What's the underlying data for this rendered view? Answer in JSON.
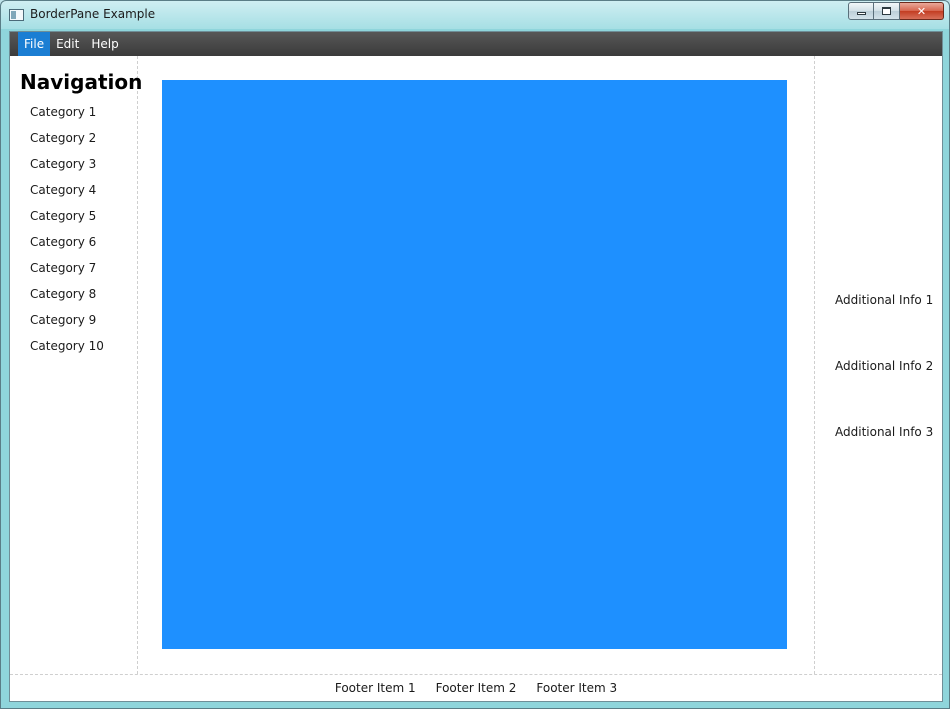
{
  "window": {
    "title": "BorderPane Example",
    "minimize_label": "",
    "maximize_label": "",
    "close_label": "✕"
  },
  "menubar": {
    "items": [
      {
        "label": "File",
        "active": true
      },
      {
        "label": "Edit",
        "active": false
      },
      {
        "label": "Help",
        "active": false
      }
    ]
  },
  "nav": {
    "title": "Navigation",
    "items": [
      {
        "label": "Category 1"
      },
      {
        "label": "Category 2"
      },
      {
        "label": "Category 3"
      },
      {
        "label": "Category 4"
      },
      {
        "label": "Category 5"
      },
      {
        "label": "Category 6"
      },
      {
        "label": "Category 7"
      },
      {
        "label": "Category 8"
      },
      {
        "label": "Category 9"
      },
      {
        "label": "Category 10"
      }
    ]
  },
  "center": {
    "fill_color": "#1e90ff"
  },
  "right": {
    "items": [
      {
        "label": "Additional Info 1"
      },
      {
        "label": "Additional Info 2"
      },
      {
        "label": "Additional Info 3"
      }
    ]
  },
  "footer": {
    "items": [
      {
        "label": "Footer Item 1"
      },
      {
        "label": "Footer Item 2"
      },
      {
        "label": "Footer Item 3"
      }
    ]
  },
  "colors": {
    "menu_active": "#1b7ed3",
    "menubar": "#3b3b3b",
    "center_fill": "#1e90ff"
  }
}
